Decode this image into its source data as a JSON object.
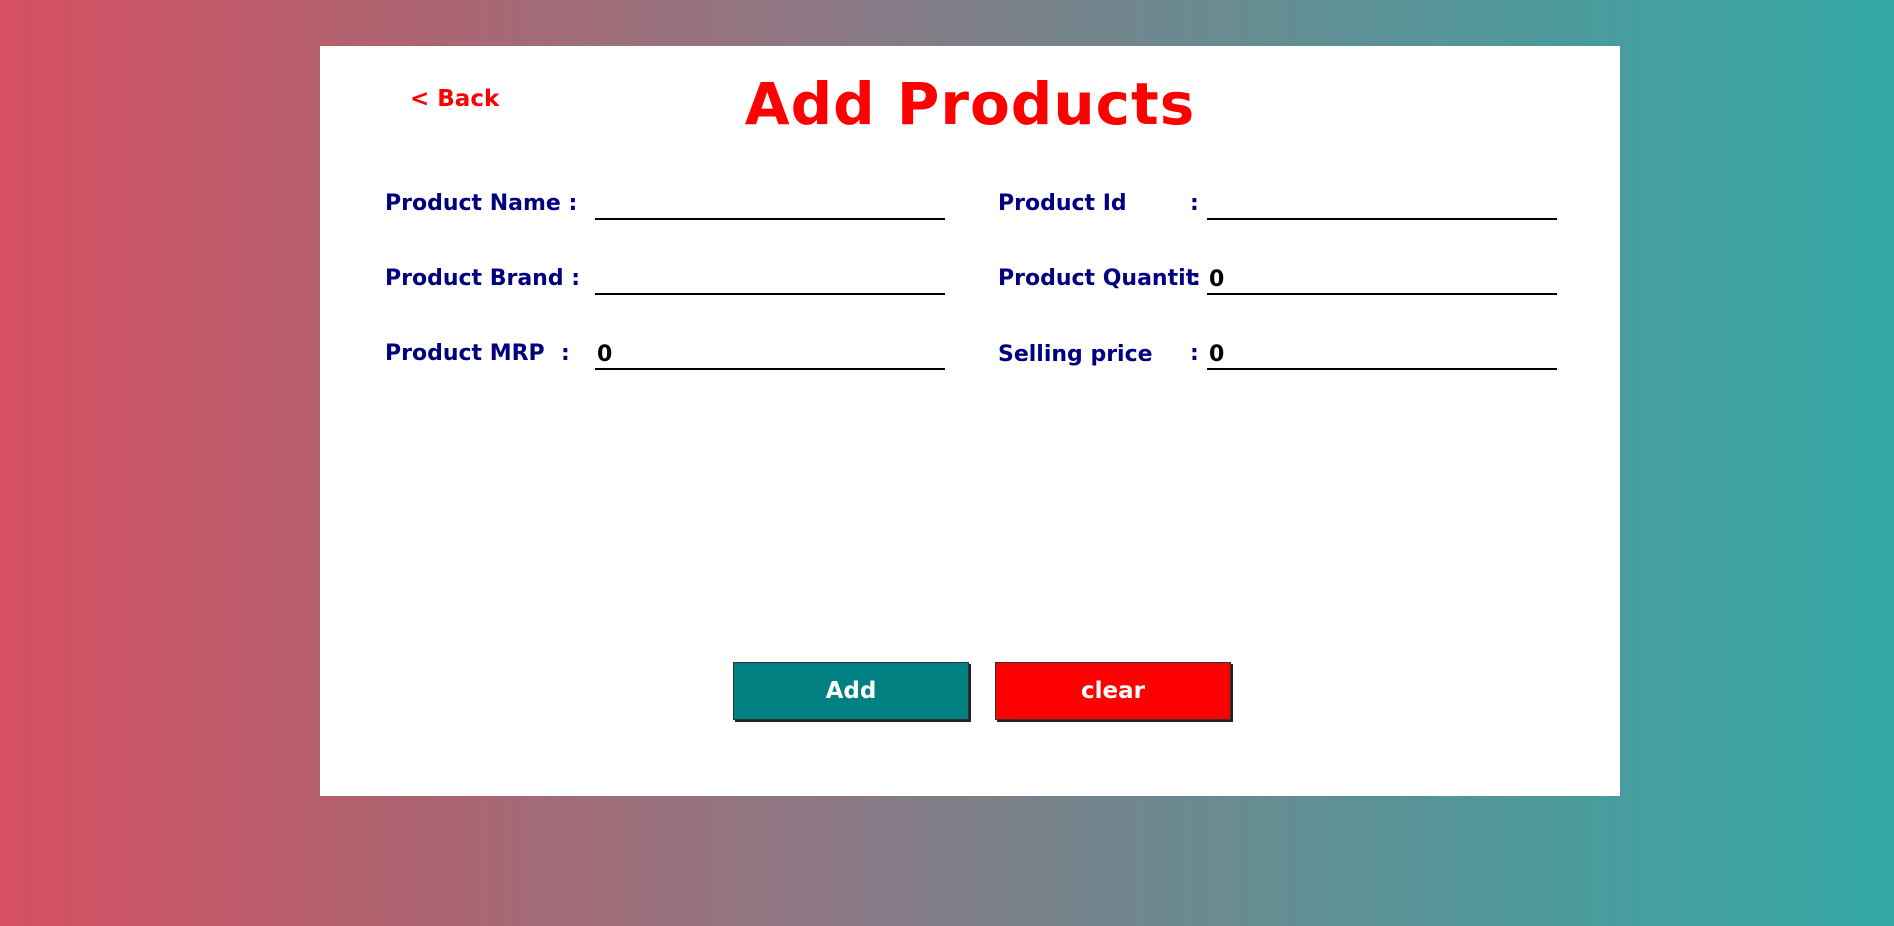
{
  "header": {
    "back_label": "< Back",
    "title": "Add Products"
  },
  "form": {
    "product_name": {
      "label": "Product Name :",
      "value": ""
    },
    "product_id": {
      "label": "Product Id",
      "value": ""
    },
    "product_brand": {
      "label": "Product Brand :",
      "value": ""
    },
    "product_quantity": {
      "label": "Product Quantit",
      "value": "0"
    },
    "product_mrp": {
      "label": "Product MRP",
      "value": "0"
    },
    "selling_price": {
      "label": "Selling price",
      "value": "0"
    },
    "colon": ":"
  },
  "actions": {
    "add_label": "Add",
    "clear_label": "clear"
  },
  "colors": {
    "title": "#ff0000",
    "label": "#000080",
    "add_button": "#008080",
    "clear_button": "#ff0000"
  }
}
